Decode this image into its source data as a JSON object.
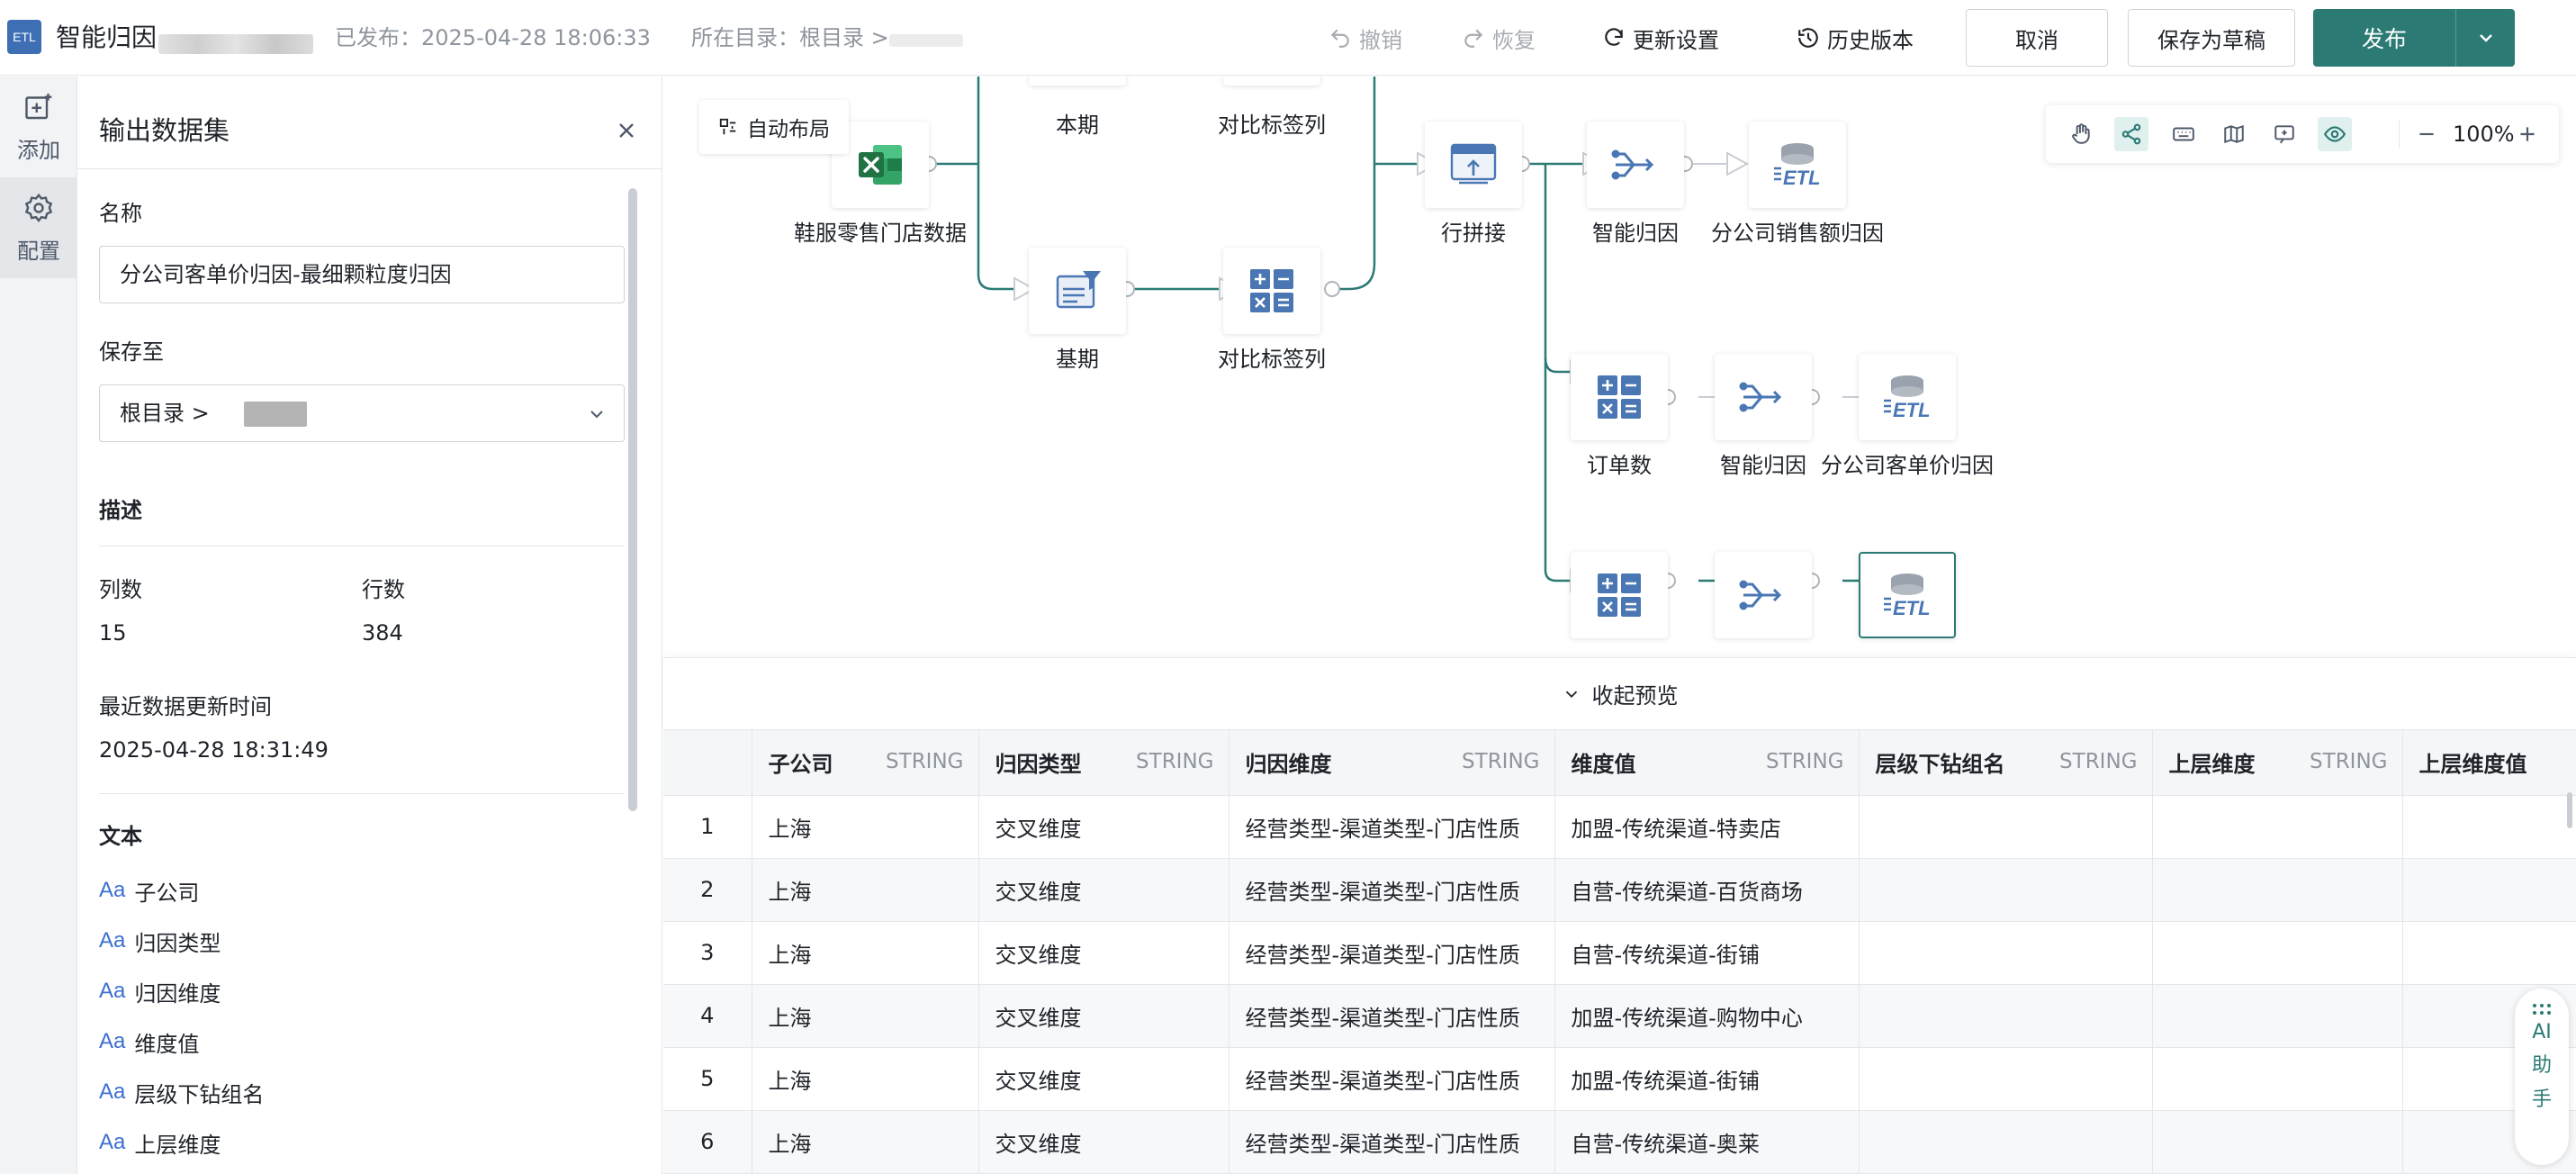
{
  "header": {
    "logo_text": "ETL",
    "title": "智能归因",
    "publish_status": "已发布：2025-04-28 18:06:33",
    "directory": "所在目录：根目录 >",
    "undo": "撤销",
    "redo": "恢复",
    "update_settings": "更新设置",
    "history": "历史版本",
    "cancel": "取消",
    "save_draft": "保存为草稿",
    "publish": "发布"
  },
  "rail": {
    "add": "添加",
    "config": "配置"
  },
  "panel": {
    "title": "输出数据集",
    "name_label": "名称",
    "name_value": "分公司客单价归因-最细颗粒度归因",
    "save_to_label": "保存至",
    "save_to_value": "根目录 >",
    "description_label": "描述",
    "columns_label": "列数",
    "columns_value": "15",
    "rows_label": "行数",
    "rows_value": "384",
    "updated_label": "最近数据更新时间",
    "updated_value": "2025-04-28 18:31:49",
    "text_section": "文本",
    "field_icon": "Aa",
    "fields": [
      "子公司",
      "归因类型",
      "归因维度",
      "维度值",
      "层级下钻组名",
      "上层维度"
    ]
  },
  "canvas": {
    "auto_layout": "自动布局",
    "zoom": "100%",
    "nodes": {
      "excel": "鞋服零售门店数据",
      "current": "本期",
      "compare_top": "对比标签列",
      "base": "基期",
      "compare_bottom": "对比标签列",
      "join": "行拼接",
      "attr1": "智能归因",
      "out1": "分公司销售额归因",
      "orders": "订单数",
      "attr2": "智能归因",
      "out2": "分公司客单价归因"
    }
  },
  "preview": {
    "collapse": "收起预览",
    "columns": [
      {
        "name": "子公司",
        "type": "STRING"
      },
      {
        "name": "归因类型",
        "type": "STRING"
      },
      {
        "name": "归因维度",
        "type": "STRING"
      },
      {
        "name": "维度值",
        "type": "STRING"
      },
      {
        "name": "层级下钻组名",
        "type": "STRING"
      },
      {
        "name": "上层维度",
        "type": "STRING"
      },
      {
        "name": "上层维度值",
        "type": ""
      }
    ],
    "rows": [
      [
        "1",
        "上海",
        "交叉维度",
        "经营类型-渠道类型-门店性质",
        "加盟-传统渠道-特卖店",
        "",
        "",
        ""
      ],
      [
        "2",
        "上海",
        "交叉维度",
        "经营类型-渠道类型-门店性质",
        "自营-传统渠道-百货商场",
        "",
        "",
        ""
      ],
      [
        "3",
        "上海",
        "交叉维度",
        "经营类型-渠道类型-门店性质",
        "自营-传统渠道-街铺",
        "",
        "",
        ""
      ],
      [
        "4",
        "上海",
        "交叉维度",
        "经营类型-渠道类型-门店性质",
        "加盟-传统渠道-购物中心",
        "",
        "",
        ""
      ],
      [
        "5",
        "上海",
        "交叉维度",
        "经营类型-渠道类型-门店性质",
        "加盟-传统渠道-街铺",
        "",
        "",
        ""
      ],
      [
        "6",
        "上海",
        "交叉维度",
        "经营类型-渠道类型-门店性质",
        "自营-传统渠道-奥莱",
        "",
        "",
        ""
      ]
    ]
  },
  "ai": {
    "label_ai": "AI",
    "label_1": "助",
    "label_2": "手"
  },
  "colors": {
    "accent": "#2b7a74",
    "node_icon": "#4a77b4"
  }
}
